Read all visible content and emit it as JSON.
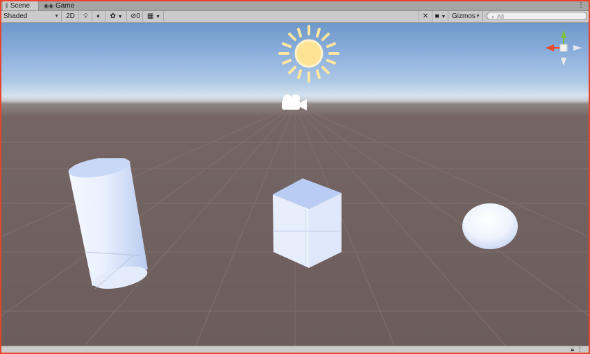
{
  "tabs": [
    {
      "label": "Scene",
      "icon": "scene-hash-icon"
    },
    {
      "label": "Game",
      "icon": "game-controller-icon"
    }
  ],
  "tab_menu_icon": "⋮",
  "toolbar": {
    "draw_mode": "Shaded",
    "mode_2d": "2D",
    "hidden_count": "0",
    "gizmos_label": "Gizmos",
    "search_placeholder": "All"
  },
  "scene_objects": [
    "cylinder",
    "cube",
    "sphere",
    "directional-light",
    "main-camera"
  ],
  "colors": {
    "window_border": "#e8442a",
    "gizmo_x": "#e84a2a",
    "gizmo_y": "#7fbf3a",
    "sun": "#ffeaa6",
    "primitive": "#d9e6ff"
  },
  "status_icons": [
    "lock-icon",
    "overflow-icon"
  ]
}
